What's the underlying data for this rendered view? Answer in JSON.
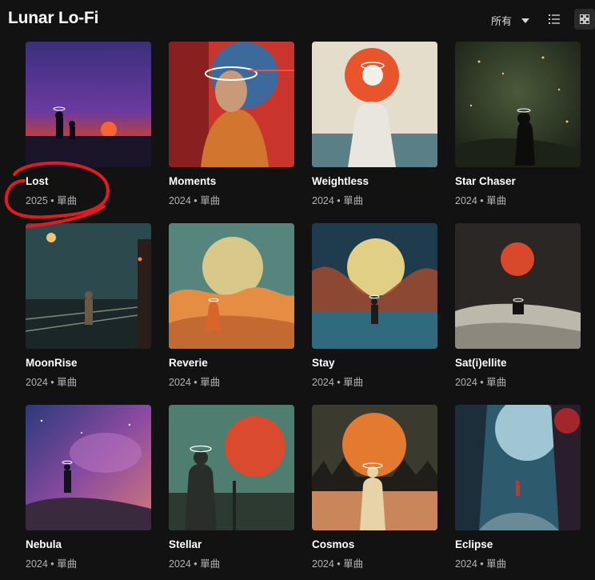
{
  "header": {
    "title": "Lunar Lo-Fi",
    "filter_label": "所有"
  },
  "icons": {
    "filter_caret": "chevron-down-icon",
    "list_view": "list-icon",
    "grid_view": "grid-icon"
  },
  "colors": {
    "background": "#121212",
    "annotation_circle": "#e01b24",
    "meta_text": "#b3b3b3"
  },
  "albums": [
    {
      "title": "Lost",
      "meta": "2025 • 單曲"
    },
    {
      "title": "Moments",
      "meta": "2024 • 單曲"
    },
    {
      "title": "Weightless",
      "meta": "2024 • 單曲"
    },
    {
      "title": "Star Chaser",
      "meta": "2024 • 單曲"
    },
    {
      "title": "MoonRise",
      "meta": "2024 • 單曲"
    },
    {
      "title": "Reverie",
      "meta": "2024 • 單曲"
    },
    {
      "title": "Stay",
      "meta": "2024 • 單曲"
    },
    {
      "title": "Sat(i)ellite",
      "meta": "2024 • 單曲"
    },
    {
      "title": "Nebula",
      "meta": "2024 • 單曲"
    },
    {
      "title": "Stellar",
      "meta": "2024 • 單曲"
    },
    {
      "title": "Cosmos",
      "meta": "2024 • 單曲"
    },
    {
      "title": "Eclipse",
      "meta": "2024 • 單曲"
    }
  ]
}
